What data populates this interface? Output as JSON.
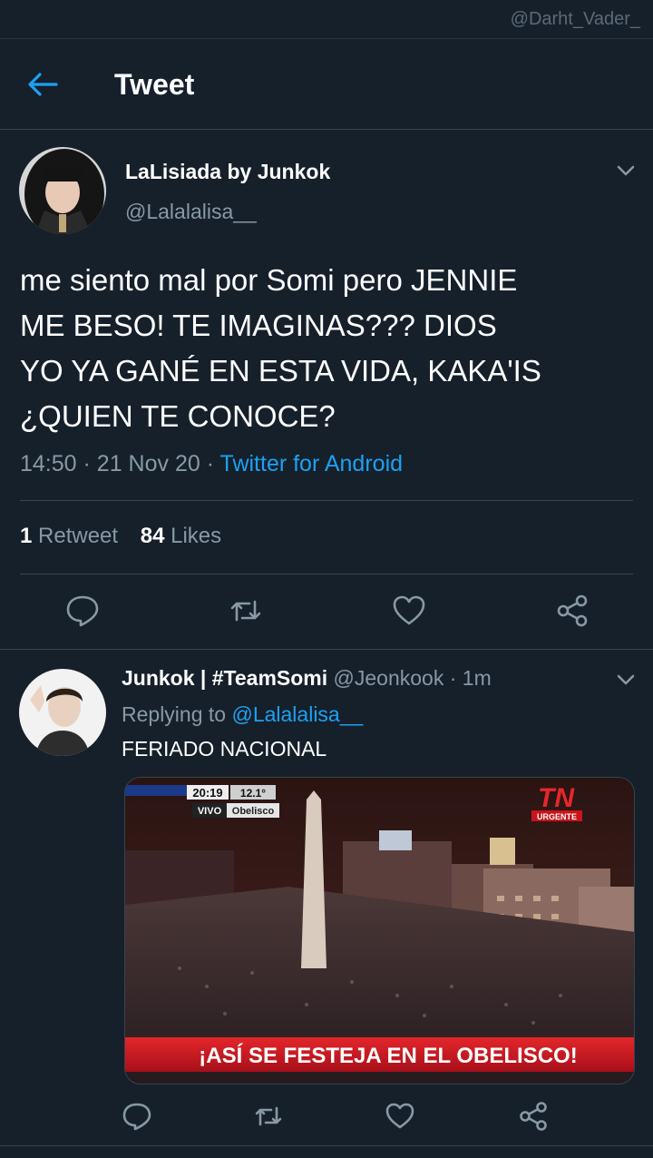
{
  "watermark": "@Darht_Vader_",
  "header": {
    "title": "Tweet"
  },
  "main_tweet": {
    "display_name": "LaLisiada by Junkok",
    "handle": "@Lalalalisa__",
    "text": "me siento mal por Somi pero JENNIE\nME BESO! TE IMAGINAS??? DIOS\nYO YA GANÉ EN ESTA VIDA, KAKA'IS\n¿QUIEN TE CONOCE?",
    "time": "14:50",
    "sep": "·",
    "date": "21 Nov 20",
    "source": "Twitter for Android",
    "retweets_count": "1",
    "retweets_label": "Retweet",
    "likes_count": "84",
    "likes_label": "Likes"
  },
  "reply_tweet": {
    "display_name": "Junkok | #TeamSomi",
    "handle": "@Jeonkook",
    "sep": "·",
    "time": "1m",
    "replying_label": "Replying to",
    "replying_to": "@Lalalalisa__",
    "text": "FERIADO NACIONAL",
    "media": {
      "clock": "20:19",
      "temp": "12.1°",
      "live": "VIVO",
      "place": "Obelisco",
      "channel_logo": "TN",
      "breaking": "URGENTE",
      "caption": "¡ASÍ SE FESTEJA EN EL OBELISCO!"
    }
  },
  "colors": {
    "background": "#15202b",
    "divider": "#38444d",
    "secondary_text": "#8899a6",
    "accent": "#1da1f2"
  },
  "icons": {
    "back": "arrow-left-icon",
    "menu": "chevron-down-icon",
    "reply": "comment-icon",
    "retweet": "retweet-icon",
    "like": "heart-icon",
    "share": "share-icon"
  }
}
